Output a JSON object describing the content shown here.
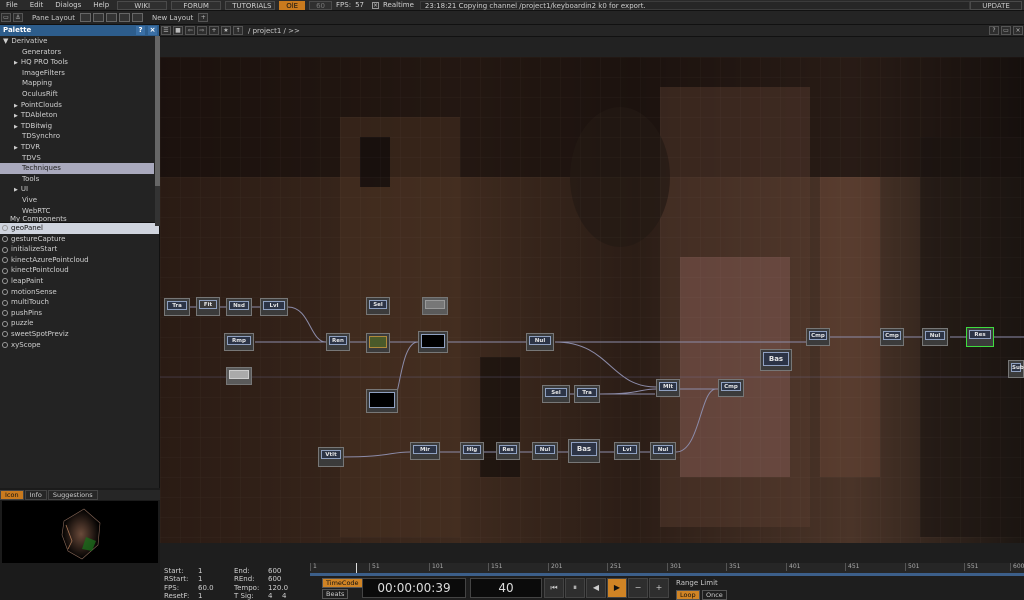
{
  "menubar": {
    "items": [
      "File",
      "Edit",
      "Dialogs",
      "Help"
    ],
    "wiki": "WIKI",
    "forum": "FORUM",
    "tutorials": "TUTORIALS",
    "ole": "OlE",
    "fps_value": "60",
    "fps_label": "FPS:",
    "fps_actual": "57",
    "realtime": "Realtime",
    "message": "23:18:21 Copying channel /project1/keyboardin2 k0 for export.",
    "update": "UPDATE"
  },
  "toolbar": {
    "pane_layout": "Pane Layout",
    "new_layout": "New Layout",
    "plus": "+"
  },
  "palette": {
    "title": "Palette",
    "help": "?",
    "close": "×",
    "tree": [
      {
        "label": "Derivative",
        "level": 0,
        "arrow": "▼"
      },
      {
        "label": "Generators",
        "level": 1,
        "arrow": ""
      },
      {
        "label": "HQ PRO Tools",
        "level": 1,
        "arrow": "▶"
      },
      {
        "label": "ImageFilters",
        "level": 1,
        "arrow": ""
      },
      {
        "label": "Mapping",
        "level": 1,
        "arrow": ""
      },
      {
        "label": "OculusRift",
        "level": 1,
        "arrow": ""
      },
      {
        "label": "PointClouds",
        "level": 1,
        "arrow": "▶"
      },
      {
        "label": "TDAbleton",
        "level": 1,
        "arrow": "▶"
      },
      {
        "label": "TDBitwig",
        "level": 1,
        "arrow": "▶"
      },
      {
        "label": "TDSynchro",
        "level": 1,
        "arrow": ""
      },
      {
        "label": "TDVR",
        "level": 1,
        "arrow": "▶"
      },
      {
        "label": "TDVS",
        "level": 1,
        "arrow": ""
      },
      {
        "label": "Techniques",
        "level": 1,
        "arrow": "",
        "selected": true
      },
      {
        "label": "Tools",
        "level": 1,
        "arrow": ""
      },
      {
        "label": "UI",
        "level": 1,
        "arrow": "▶"
      },
      {
        "label": "Vive",
        "level": 1,
        "arrow": ""
      },
      {
        "label": "WebRTC",
        "level": 1,
        "arrow": ""
      },
      {
        "label": "My Components",
        "level": 0,
        "arrow": ""
      }
    ],
    "components": [
      {
        "label": "geoPanel",
        "selected": true
      },
      {
        "label": "gestureCapture"
      },
      {
        "label": "initializeStart"
      },
      {
        "label": "kinectAzurePointcloud"
      },
      {
        "label": "kinectPointcloud"
      },
      {
        "label": "leapPaint"
      },
      {
        "label": "motionSense"
      },
      {
        "label": "multiTouch"
      },
      {
        "label": "pushPins"
      },
      {
        "label": "puzzle"
      },
      {
        "label": "sweetSpotPreviz"
      },
      {
        "label": "xyScope"
      }
    ]
  },
  "preview_tabs": [
    "Icon",
    "Info",
    "Suggestions"
  ],
  "network": {
    "path": "/ project1 / >>",
    "nodes": [
      {
        "label": "Tra"
      },
      {
        "label": "Fit"
      },
      {
        "label": "Nsd"
      },
      {
        "label": "Lvl"
      },
      {
        "label": "Sel"
      },
      {
        "label": "Rmp"
      },
      {
        "label": "Ren"
      },
      {
        "label": "Nul"
      },
      {
        "label": "Cmp"
      },
      {
        "label": "Bas"
      },
      {
        "label": "Sel"
      },
      {
        "label": "Tra"
      },
      {
        "label": "Mlt"
      },
      {
        "label": "Cmp"
      },
      {
        "label": "Nul"
      },
      {
        "label": "Res"
      },
      {
        "label": "Vtlt"
      },
      {
        "label": "Mir"
      },
      {
        "label": "Hlg"
      },
      {
        "label": "Res"
      },
      {
        "label": "Nul"
      },
      {
        "label": "Bas"
      },
      {
        "label": "Lvl"
      },
      {
        "label": "Nul"
      },
      {
        "label": "Sub"
      }
    ]
  },
  "timeline": {
    "start_label": "Start:",
    "start": "1",
    "end_label": "End:",
    "end": "600",
    "rstart_label": "RStart:",
    "rstart": "1",
    "rend_label": "REnd:",
    "rend": "600",
    "fps_label": "FPS:",
    "fps": "60.0",
    "tempo_label": "Tempo:",
    "tempo": "120.0",
    "resetf_label": "ResetF:",
    "resetf": "1",
    "tsig_label": "T Sig:",
    "tsig_a": "4",
    "tsig_b": "4",
    "ticks": [
      "1",
      "51",
      "101",
      "151",
      "201",
      "251",
      "301",
      "351",
      "401",
      "451",
      "501",
      "551",
      "600"
    ],
    "timecode_btn": "TimeCode",
    "beats_btn": "Beats",
    "timecode": "00:00:00:39",
    "frame": "40",
    "range_limit": "Range Limit",
    "loop": "Loop",
    "once": "Once"
  }
}
